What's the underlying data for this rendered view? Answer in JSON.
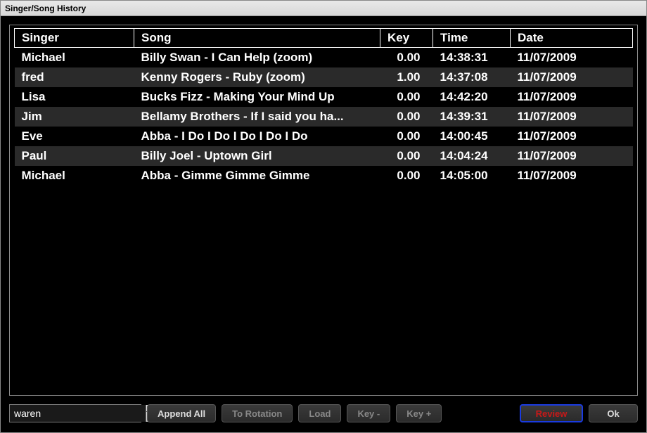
{
  "window": {
    "title": "Singer/Song History"
  },
  "table": {
    "headers": {
      "singer": "Singer",
      "song": "Song",
      "key": "Key",
      "time": "Time",
      "date": "Date"
    },
    "rows": [
      {
        "singer": "Michael",
        "song": "Billy Swan - I Can Help (zoom)",
        "key": "0.00",
        "time": "14:38:31",
        "date": "11/07/2009"
      },
      {
        "singer": "fred",
        "song": "Kenny Rogers - Ruby (zoom)",
        "key": "1.00",
        "time": "14:37:08",
        "date": "11/07/2009"
      },
      {
        "singer": "Lisa",
        "song": "Bucks Fizz - Making Your Mind Up",
        "key": "0.00",
        "time": "14:42:20",
        "date": "11/07/2009"
      },
      {
        "singer": "Jim",
        "song": "Bellamy Brothers - If I said you ha...",
        "key": "0.00",
        "time": "14:39:31",
        "date": "11/07/2009"
      },
      {
        "singer": "Eve",
        "song": "Abba - I Do I Do I Do I Do I Do",
        "key": "0.00",
        "time": "14:00:45",
        "date": "11/07/2009"
      },
      {
        "singer": "Paul",
        "song": "Billy Joel - Uptown Girl",
        "key": "0.00",
        "time": "14:04:24",
        "date": "11/07/2009"
      },
      {
        "singer": "Michael",
        "song": "Abba - Gimme Gimme Gimme",
        "key": "0.00",
        "time": "14:05:00",
        "date": "11/07/2009"
      }
    ]
  },
  "bottom": {
    "combo_value": "waren",
    "append_all": "Append All",
    "to_rotation": "To Rotation",
    "load": "Load",
    "key_minus": "Key -",
    "key_plus": "Key +",
    "review": "Review",
    "ok": "Ok"
  }
}
